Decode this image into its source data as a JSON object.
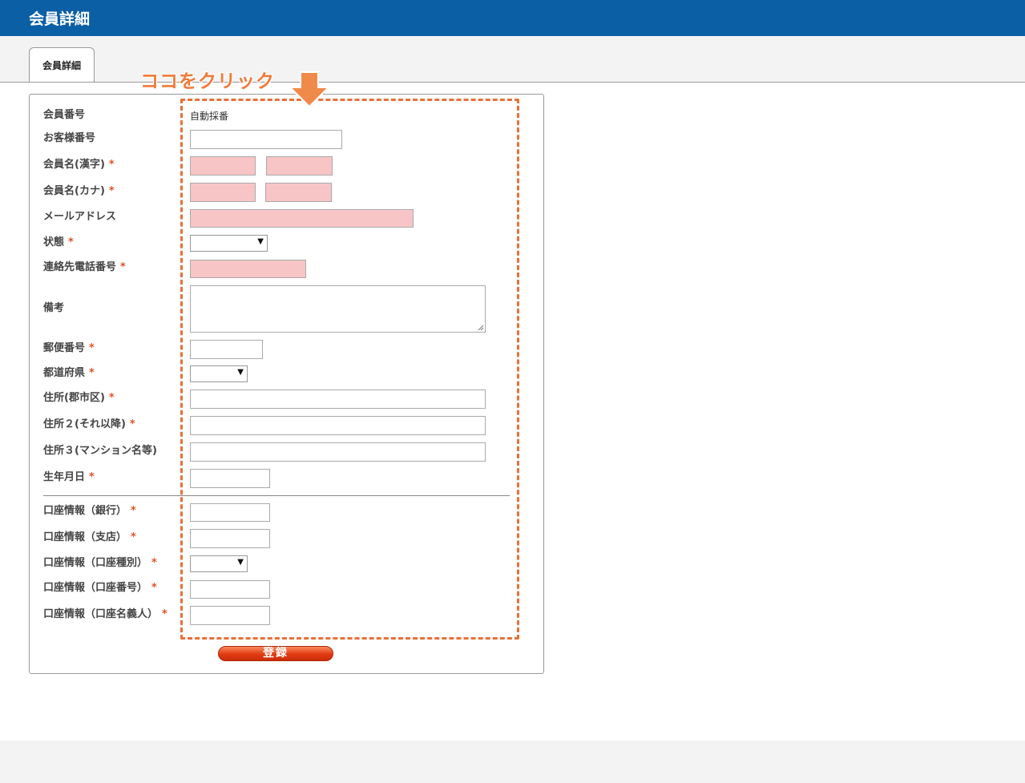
{
  "header": {
    "title": "会員詳細"
  },
  "tabs": [
    {
      "label": "会員詳細"
    }
  ],
  "annotation": {
    "text": "ココをクリック"
  },
  "form": {
    "member_no": {
      "label": "会員番号",
      "value": "自動採番"
    },
    "customer_no": {
      "label": "お客様番号",
      "value": ""
    },
    "name_kanji": {
      "label": "会員名(漢字)",
      "required": "*",
      "last": "",
      "first": ""
    },
    "name_kana": {
      "label": "会員名(カナ)",
      "required": "*",
      "last": "",
      "first": ""
    },
    "email": {
      "label": "メールアドレス",
      "value": ""
    },
    "status": {
      "label": "状態",
      "required": "*",
      "selected": ""
    },
    "phone": {
      "label": "連絡先電話番号",
      "required": "*",
      "value": ""
    },
    "notes": {
      "label": "備考",
      "value": ""
    },
    "postal": {
      "label": "郵便番号",
      "required": "*",
      "value": ""
    },
    "prefecture": {
      "label": "都道府県",
      "required": "*",
      "selected": ""
    },
    "address1": {
      "label": "住所(郡市区)",
      "required": "*",
      "value": ""
    },
    "address2": {
      "label": "住所２(それ以降)",
      "required": "*",
      "value": ""
    },
    "address3": {
      "label": "住所３(マンション名等)",
      "value": ""
    },
    "birthday": {
      "label": "生年月日",
      "required": "*",
      "value": ""
    },
    "bank": {
      "label": "口座情報（銀行）",
      "required": "*",
      "value": ""
    },
    "branch": {
      "label": "口座情報（支店）",
      "required": "*",
      "value": ""
    },
    "account_type": {
      "label": "口座情報（口座種別）",
      "required": "*",
      "selected": ""
    },
    "account_no": {
      "label": "口座情報（口座番号）",
      "required": "*",
      "value": ""
    },
    "account_name": {
      "label": "口座情報（口座名義人）",
      "required": "*",
      "value": ""
    },
    "submit_label": "登録"
  },
  "colors": {
    "header_bg": "#0b5fa5",
    "required_field_bg": "#f7c5c5",
    "accent": "#e8703a",
    "submit": "#e23a12"
  }
}
